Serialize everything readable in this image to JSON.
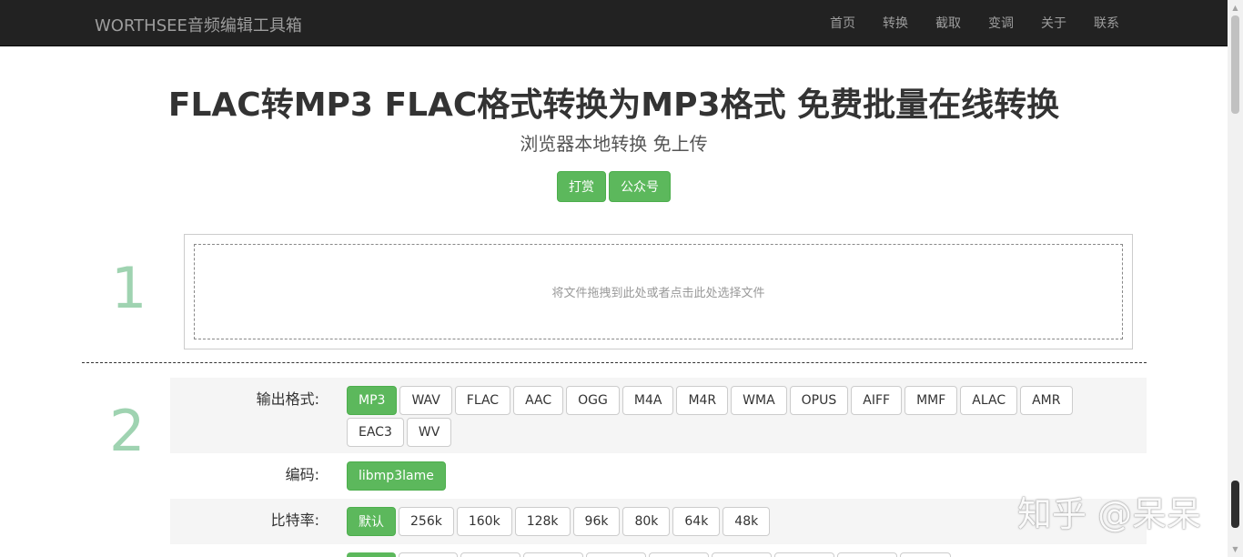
{
  "navbar": {
    "brand": "WORTHSEE音频编辑工具箱",
    "links": [
      "首页",
      "转换",
      "截取",
      "变调",
      "关于",
      "联系"
    ]
  },
  "header": {
    "title": "FLAC转MP3 FLAC格式转换为MP3格式 免费批量在线转换",
    "subtitle": "浏览器本地转换 免上传",
    "buttons": [
      "打赏",
      "公众号"
    ]
  },
  "step1": {
    "number": "1",
    "dropzone_text": "将文件拖拽到此处或者点击此处选择文件"
  },
  "step2": {
    "number": "2",
    "output_format": {
      "label": "输出格式:",
      "options": [
        "MP3",
        "WAV",
        "FLAC",
        "AAC",
        "OGG",
        "M4A",
        "M4R",
        "WMA",
        "OPUS",
        "AIFF",
        "MMF",
        "ALAC",
        "AMR",
        "EAC3",
        "WV"
      ],
      "selected": "MP3"
    },
    "codec": {
      "label": "编码:",
      "options": [
        "libmp3lame"
      ],
      "selected": "libmp3lame"
    },
    "bitrate": {
      "label": "比特率:",
      "options": [
        "默认",
        "256k",
        "160k",
        "128k",
        "96k",
        "80k",
        "64k",
        "48k"
      ],
      "selected": "默认"
    }
  },
  "watermark": "知乎 @呆呆",
  "colors": {
    "navbar_bg": "#222222",
    "accent_green": "#5cb85c",
    "step_number": "#9fd3b1"
  }
}
